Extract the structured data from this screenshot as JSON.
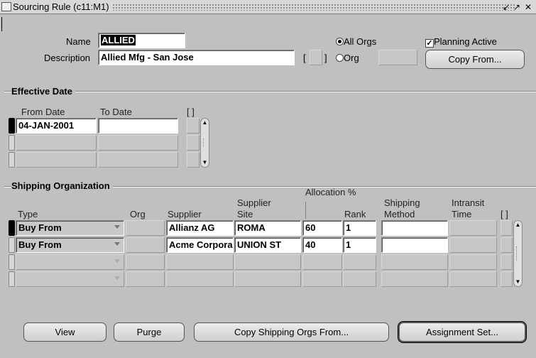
{
  "window": {
    "title": "Sourcing Rule (c11:M1)",
    "controls": [
      "minimize-icon",
      "maximize-icon",
      "close-icon"
    ]
  },
  "header": {
    "name_label": "Name",
    "name_value": "ALLIED",
    "description_label": "Description",
    "description_value": "Allied Mfg - San Jose",
    "flex_bracket": "[   ]",
    "all_orgs_label": "All Orgs",
    "org_label": "Org",
    "all_orgs_selected": true,
    "planning_active_label": "Planning Active",
    "planning_active_checked": true,
    "copy_from_label": "Copy From..."
  },
  "effective_date": {
    "section_title": "Effective Date",
    "col_from": "From Date",
    "col_to": "To Date",
    "bracket": "[ ]",
    "rows": [
      {
        "from": "04-JAN-2001",
        "to": ""
      },
      {
        "from": "",
        "to": ""
      },
      {
        "from": "",
        "to": ""
      }
    ]
  },
  "shipping": {
    "section_title": "Shipping Organization",
    "allocation_header": "Allocation %",
    "columns": {
      "type": "Type",
      "org": "Org",
      "supplier": "Supplier",
      "supplier_site": "Supplier\nSite",
      "allocation": "",
      "rank": "Rank",
      "shipping_method": "Shipping\nMethod",
      "intransit_time": "Intransit\nTime",
      "bracket": "[ ]"
    },
    "rows": [
      {
        "type": "Buy From",
        "org": "",
        "supplier": "Allianz AG",
        "site": "ROMA",
        "allocation": "60",
        "rank": "1",
        "method": "",
        "intransit": ""
      },
      {
        "type": "Buy From",
        "org": "",
        "supplier": "Acme Corpora",
        "site": "UNION ST",
        "allocation": "40",
        "rank": "1",
        "method": "",
        "intransit": ""
      },
      {
        "type": "",
        "org": "",
        "supplier": "",
        "site": "",
        "allocation": "",
        "rank": "",
        "method": "",
        "intransit": ""
      },
      {
        "type": "",
        "org": "",
        "supplier": "",
        "site": "",
        "allocation": "",
        "rank": "",
        "method": "",
        "intransit": ""
      }
    ]
  },
  "footer": {
    "view_label": "View",
    "purge_label": "Purge",
    "copy_shipping_label": "Copy Shipping Orgs From...",
    "assignment_set_label": "Assignment Set..."
  }
}
